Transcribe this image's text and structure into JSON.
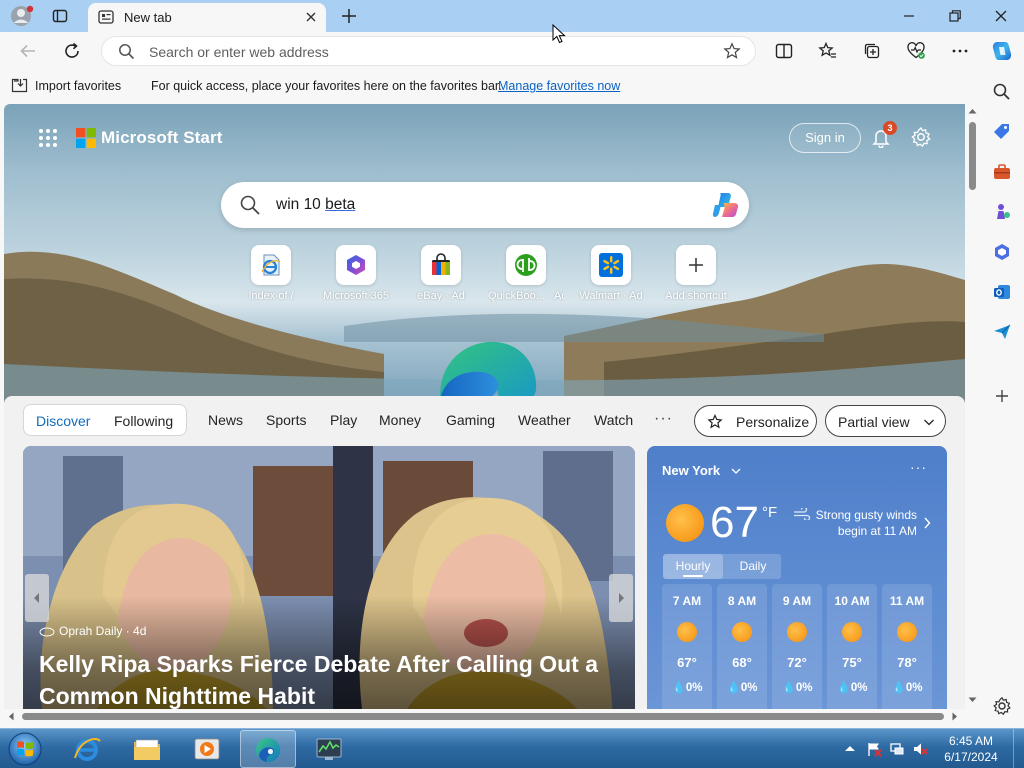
{
  "browser": {
    "tab_title": "New tab",
    "address_placeholder": "Search or enter web address"
  },
  "favorites_bar": {
    "import_label": "Import favorites",
    "message": "For quick access, place your favorites here on the favorites bar.",
    "manage_link": "Manage favorites now"
  },
  "start_page": {
    "brand": "Microsoft Start",
    "sign_in": "Sign in",
    "notification_count": "3",
    "search_query_prefix": "win 10 ",
    "search_query_underlined": "beta",
    "shortcuts": [
      {
        "label": "Index of /",
        "icon": "ie-page-icon"
      },
      {
        "label": "Microsoft 365",
        "icon": "microsoft-365-icon"
      },
      {
        "label": "eBay · Ad",
        "icon": "ebay-bag-icon"
      },
      {
        "label": "QuickBoo... · Ad",
        "icon": "quickbooks-icon"
      },
      {
        "label": "Walmart · Ad",
        "icon": "walmart-spark-icon"
      },
      {
        "label": "Add shortcut",
        "icon": "plus-icon"
      }
    ]
  },
  "feed": {
    "tabs": {
      "discover": "Discover",
      "following": "Following"
    },
    "nav_items": [
      "News",
      "Sports",
      "Play",
      "Money",
      "Gaming",
      "Weather",
      "Watch"
    ],
    "more": "···",
    "personalize": "Personalize",
    "view_mode": "Partial view",
    "article": {
      "source": "Oprah Daily · 4d",
      "headline": "Kelly Ripa Sparks Fierce Debate After Calling Out a Common Nighttime Habit"
    },
    "weather": {
      "city": "New York",
      "more": "···",
      "temperature": "67",
      "unit": "°F",
      "alert": "Strong gusty winds begin at 11 AM",
      "tab_hourly": "Hourly",
      "tab_daily": "Daily",
      "hourly": [
        {
          "time": "7 AM",
          "temp": "67°",
          "precip": "0%"
        },
        {
          "time": "8 AM",
          "temp": "68°",
          "precip": "0%"
        },
        {
          "time": "9 AM",
          "temp": "72°",
          "precip": "0%"
        },
        {
          "time": "10 AM",
          "temp": "75°",
          "precip": "0%"
        },
        {
          "time": "11 AM",
          "temp": "78°",
          "precip": "0%"
        }
      ]
    }
  },
  "taskbar": {
    "time": "6:45 AM",
    "date": "6/17/2024"
  },
  "colors": {
    "titlebar": "#a9d0f3",
    "link": "#0b63c4",
    "accent": "#0f6cbd",
    "weather_card": "#5a89d0",
    "taskbar": "#2e6aa3"
  }
}
